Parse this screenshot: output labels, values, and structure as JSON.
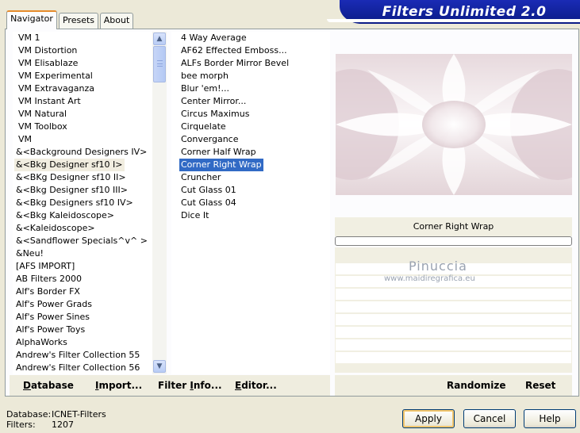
{
  "app": {
    "title": "Filters Unlimited 2.0"
  },
  "tabs": [
    {
      "label": "Navigator",
      "active": true
    },
    {
      "label": "Presets",
      "active": false
    },
    {
      "label": "About",
      "active": false
    }
  ],
  "categories": {
    "items": [
      "VM 1",
      "VM Distortion",
      "VM Elisablaze",
      "VM Experimental",
      "VM Extravaganza",
      "VM Instant Art",
      "VM Natural",
      "VM Toolbox",
      "VM",
      "&<Background Designers IV>",
      "&<Bkg Designer sf10 I>",
      "&<BKg Designer sf10 II>",
      "&<Bkg Designer sf10 III>",
      "&<Bkg Designers sf10 IV>",
      "&<Bkg Kaleidoscope>",
      "&<Kaleidoscope>",
      "&<Sandflower Specials^v^ >",
      "&Neu!",
      "[AFS IMPORT]",
      "AB Filters 2000",
      "Alf's Border FX",
      "Alf's Power Grads",
      "Alf's Power Sines",
      "Alf's Power Toys",
      "AlphaWorks",
      "Andrew's Filter Collection 55",
      "Andrew's Filter Collection 56"
    ],
    "selected_index": 10
  },
  "filters": {
    "items": [
      "4 Way Average",
      "AF62 Effected Emboss...",
      "ALFs Border Mirror Bevel",
      "bee morph",
      "Blur 'em!...",
      "Center Mirror...",
      "Circus Maximus",
      "Cirquelate",
      "Convergance",
      "Corner Half Wrap",
      "Corner Right Wrap",
      "Cruncher",
      "Cut Glass 01",
      "Cut Glass 04",
      "Dice It"
    ],
    "selected_index": 10
  },
  "preview": {
    "filter_name": "Corner Right Wrap",
    "progress": 0
  },
  "watermark": {
    "name": "Pinuccia",
    "url": "www.maidiregrafica.eu"
  },
  "toolbar": {
    "database": {
      "pre": "",
      "ul": "D",
      "post": "atabase"
    },
    "import": {
      "pre": "",
      "ul": "I",
      "post": "mport..."
    },
    "filter_info": {
      "pre": "Filter ",
      "ul": "I",
      "post": "nfo..."
    },
    "editor": {
      "pre": "",
      "ul": "E",
      "post": "ditor..."
    },
    "randomize": "Randomize",
    "reset": "Reset"
  },
  "footer": {
    "database_label": "Database:",
    "database_value": "ICNET-Filters",
    "filters_label": "Filters:",
    "filters_value": "1207"
  },
  "buttons": {
    "apply": "Apply",
    "cancel": "Cancel",
    "help": "Help"
  },
  "colors": {
    "banner": "#0a1a86",
    "selection": "#316ac5",
    "tab_accent": "#e68b2c"
  },
  "icons": {
    "scroll_up": "chevron-up-icon",
    "scroll_down": "chevron-down-icon"
  }
}
